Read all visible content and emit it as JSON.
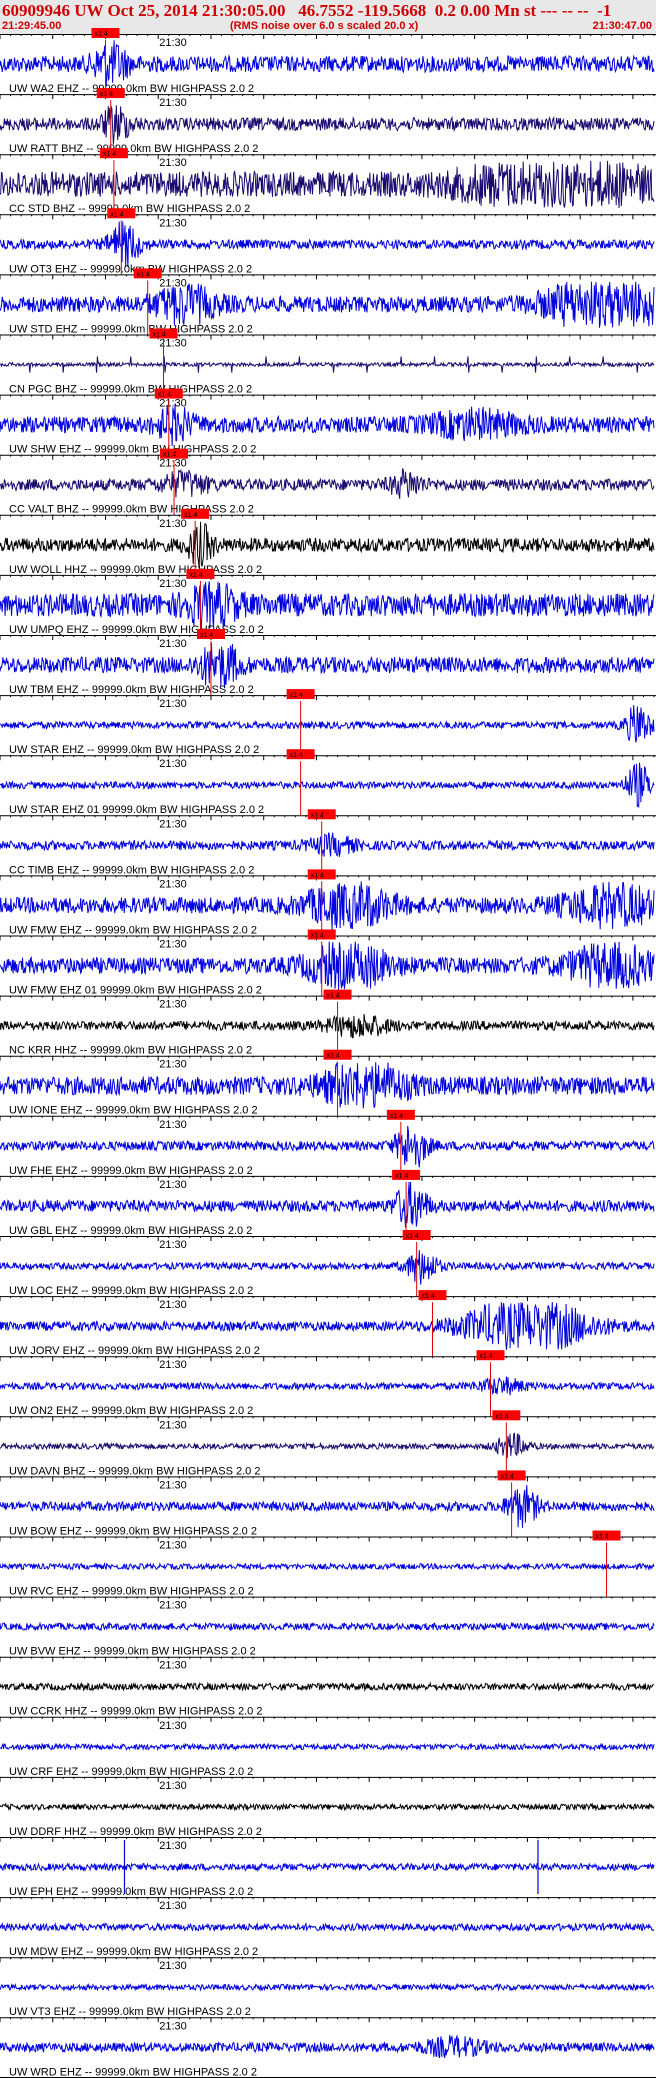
{
  "header": {
    "title": "60909946 UW Oct 25, 2014 21:30:05.00   46.7552 -119.5668  0.2 0.00 Mn st --- -- --  -1",
    "start_time": "21:29:45.00",
    "note": "(RMS noise over 6.0 s scaled 20.0 x)",
    "end_time": "21:30:47.00"
  },
  "chart_data": {
    "type": "seismogram",
    "time_start": "21:29:45.00",
    "time_end": "21:30:47.00",
    "time_span_s": 62,
    "tick_label": "21:30",
    "tick_time_s": 15,
    "pick_label": "x1 4",
    "series": [
      {
        "label": "UW WA2 EHZ -- 99999.0km BW  HIGHPASS  2.0  2",
        "color": "#0000e0",
        "amp": 0.35,
        "pick_s": 10.0,
        "bursts": [
          [
            10.5,
            1.0,
            1.0
          ]
        ]
      },
      {
        "label": "UW RATT BHZ -- 99999.0km BW  HIGHPASS  2.0  2",
        "color": "#1a0a70",
        "amp": 0.28,
        "pick_s": 10.5,
        "bursts": [
          [
            11.0,
            0.7,
            0.9
          ]
        ]
      },
      {
        "label": "CC STD BHZ -- 99999.0km BW  HIGHPASS  2.0  2",
        "color": "#1a0a70",
        "amp": 0.55,
        "pick_s": 10.8,
        "bursts": [
          [
            55.0,
            0.7,
            5.0
          ],
          [
            47.0,
            0.35,
            3.0
          ]
        ]
      },
      {
        "label": "UW OT3 EHZ -- 99999.0km BW  HIGHPASS  2.0  2",
        "color": "#0000e0",
        "amp": 0.2,
        "pick_s": 11.5,
        "bursts": [
          [
            11.8,
            0.9,
            1.0
          ]
        ]
      },
      {
        "label": "UW STD EHZ -- 99999.0km BW  HIGHPASS  2.0  2",
        "color": "#0000e0",
        "amp": 0.35,
        "pick_s": 14.0,
        "bursts": [
          [
            17.5,
            0.7,
            2.0
          ],
          [
            56.0,
            1.0,
            3.0
          ],
          [
            60.5,
            0.8,
            1.2
          ]
        ]
      },
      {
        "label": "CN PGC BHZ -- 99999.0km BW  HIGHPASS  2.0  2",
        "color": "#1a0a70",
        "amp": 0.08,
        "pick_s": 15.5,
        "spikes": true,
        "bursts": []
      },
      {
        "label": "UW SHW EHZ -- 99999.0km BW  HIGHPASS  2.0  2",
        "color": "#0000e0",
        "amp": 0.35,
        "pick_s": 16.0,
        "bursts": [
          [
            16.5,
            0.6,
            1.2
          ],
          [
            45.0,
            0.45,
            3.0
          ]
        ]
      },
      {
        "label": "CC VALT BHZ -- 99999.0km BW  HIGHPASS  2.0  2",
        "color": "#1a0a70",
        "amp": 0.25,
        "pick_s": 16.5,
        "bursts": [
          [
            17.5,
            0.45,
            1.5
          ],
          [
            38.5,
            0.5,
            1.0
          ]
        ]
      },
      {
        "label": "UW WOLL HHZ -- 99999.0km BW  HIGHPASS  2.0  2",
        "color": "#000000",
        "amp": 0.3,
        "pick_s": 18.5,
        "bursts": [
          [
            19.0,
            0.8,
            0.8
          ]
        ]
      },
      {
        "label": "UW UMPQ EHZ -- 99999.0km BW  HIGHPASS  2.0  2",
        "color": "#0000e0",
        "amp": 0.5,
        "pick_s": 19.0,
        "bursts": [
          [
            20.0,
            0.8,
            1.5
          ]
        ]
      },
      {
        "label": "UW TBM EHZ -- 99999.0km BW  HIGHPASS  2.0  2",
        "color": "#0000e0",
        "amp": 0.35,
        "pick_s": 20.0,
        "bursts": [
          [
            20.8,
            1.0,
            1.2
          ]
        ]
      },
      {
        "label": "UW STAR EHZ -- 99999.0km BW  HIGHPASS  2.0  2",
        "color": "#0000e0",
        "amp": 0.15,
        "pick_s": 28.5,
        "bursts": [
          [
            60.5,
            0.9,
            0.8
          ]
        ]
      },
      {
        "label": "UW STAR EHZ 01 99999.0km BW  HIGHPASS  2.0  2",
        "color": "#0000e0",
        "amp": 0.15,
        "pick_s": 28.5,
        "bursts": [
          [
            60.5,
            0.9,
            0.8
          ]
        ]
      },
      {
        "label": "CC TIMB EHZ -- 99999.0km BW  HIGHPASS  2.0  2",
        "color": "#0000e0",
        "amp": 0.2,
        "pick_s": 30.5,
        "bursts": [
          [
            31.5,
            0.35,
            1.5
          ]
        ]
      },
      {
        "label": "UW FMW EHZ -- 99999.0km BW  HIGHPASS  2.0  2",
        "color": "#0000e0",
        "amp": 0.35,
        "pick_s": 30.5,
        "bursts": [
          [
            33.0,
            1.0,
            2.5
          ],
          [
            58.0,
            0.8,
            3.0
          ]
        ]
      },
      {
        "label": "UW FMW EHZ 01 99999.0km BW  HIGHPASS  2.0  2",
        "color": "#0000e0",
        "amp": 0.35,
        "pick_s": 30.5,
        "bursts": [
          [
            33.0,
            1.0,
            2.5
          ],
          [
            58.0,
            0.8,
            3.0
          ]
        ]
      },
      {
        "label": "NC KRR HHZ -- 99999.0km BW  HIGHPASS  2.0  2",
        "color": "#000000",
        "amp": 0.2,
        "pick_s": 32.0,
        "bursts": [
          [
            34.0,
            0.4,
            2.0
          ]
        ]
      },
      {
        "label": "UW IONE EHZ -- 99999.0km BW  HIGHPASS  2.0  2",
        "color": "#0000e0",
        "amp": 0.4,
        "pick_s": 32.0,
        "bursts": [
          [
            34.5,
            1.0,
            2.5
          ]
        ]
      },
      {
        "label": "UW FHE EHZ -- 99999.0km BW  HIGHPASS  2.0  2",
        "color": "#0000e0",
        "amp": 0.2,
        "pick_s": 38.0,
        "bursts": [
          [
            39.0,
            1.0,
            1.0
          ]
        ]
      },
      {
        "label": "UW GBL EHZ -- 99999.0km BW  HIGHPASS  2.0  2",
        "color": "#0000e0",
        "amp": 0.25,
        "pick_s": 38.5,
        "bursts": [
          [
            39.0,
            1.0,
            1.0
          ]
        ]
      },
      {
        "label": "UW LOC EHZ -- 99999.0km BW  HIGHPASS  2.0  2",
        "color": "#0000e0",
        "amp": 0.15,
        "pick_s": 39.5,
        "bursts": [
          [
            40.0,
            0.7,
            1.0
          ]
        ]
      },
      {
        "label": "UW JORV EHZ -- 99999.0km BW  HIGHPASS  2.0  2",
        "color": "#0000e0",
        "amp": 0.2,
        "pick_s": 41.0,
        "bursts": [
          [
            50.0,
            1.2,
            4.0
          ]
        ]
      },
      {
        "label": "UW ON2 EHZ -- 99999.0km BW  HIGHPASS  2.0  2",
        "color": "#0000e0",
        "amp": 0.15,
        "pick_s": 46.5,
        "bursts": [
          [
            47.5,
            0.3,
            1.5
          ]
        ]
      },
      {
        "label": "UW DAVN BHZ -- 99999.0km BW  HIGHPASS  2.0  2",
        "color": "#1a0a70",
        "amp": 0.12,
        "pick_s": 48.0,
        "bursts": [
          [
            48.5,
            0.5,
            1.0
          ]
        ]
      },
      {
        "label": "UW BOW EHZ -- 99999.0km BW  HIGHPASS  2.0  2",
        "color": "#0000e0",
        "amp": 0.2,
        "pick_s": 48.5,
        "bursts": [
          [
            49.5,
            0.8,
            1.0
          ]
        ]
      },
      {
        "label": "UW RVC EHZ -- 99999.0km BW  HIGHPASS  2.0  2",
        "color": "#0000e0",
        "amp": 0.12,
        "pick_s": 57.5,
        "bursts": []
      },
      {
        "label": "UW BVW EHZ -- 99999.0km BW  HIGHPASS  2.0  2",
        "color": "#0000e0",
        "amp": 0.15,
        "pick_s": null,
        "bursts": []
      },
      {
        "label": "UW CCRK HHZ -- 99999.0km BW  HIGHPASS  2.0  2",
        "color": "#000000",
        "amp": 0.15,
        "pick_s": null,
        "bursts": []
      },
      {
        "label": "UW CRF EHZ -- 99999.0km BW  HIGHPASS  2.0  2",
        "color": "#0000e0",
        "amp": 0.12,
        "pick_s": null,
        "bursts": []
      },
      {
        "label": "UW DDRF HHZ -- 99999.0km BW  HIGHPASS  2.0  2",
        "color": "#000000",
        "amp": 0.12,
        "pick_s": null,
        "bursts": []
      },
      {
        "label": "UW EPH EHZ -- 99999.0km BW  HIGHPASS  2.0  2",
        "color": "#0000e0",
        "amp": 0.15,
        "pick_s": null,
        "bursts": [],
        "glitches": [
          11.8,
          51.0
        ]
      },
      {
        "label": "UW MDW EHZ -- 99999.0km BW  HIGHPASS  2.0  2",
        "color": "#0000e0",
        "amp": 0.15,
        "pick_s": null,
        "bursts": []
      },
      {
        "label": "UW VT3 EHZ -- 99999.0km BW  HIGHPASS  2.0  2",
        "color": "#0000e0",
        "amp": 0.12,
        "pick_s": null,
        "bursts": []
      },
      {
        "label": "UW WRD EHZ -- 99999.0km BW  HIGHPASS  2.0  2",
        "color": "#0000e0",
        "amp": 0.2,
        "pick_s": null,
        "bursts": [
          [
            43.0,
            0.35,
            2.0
          ]
        ]
      }
    ],
    "colors": {
      "pick": "#e00000",
      "pick_box": "#ff0000",
      "title": "#d00000",
      "header_bg": "#e8e8e8"
    }
  }
}
